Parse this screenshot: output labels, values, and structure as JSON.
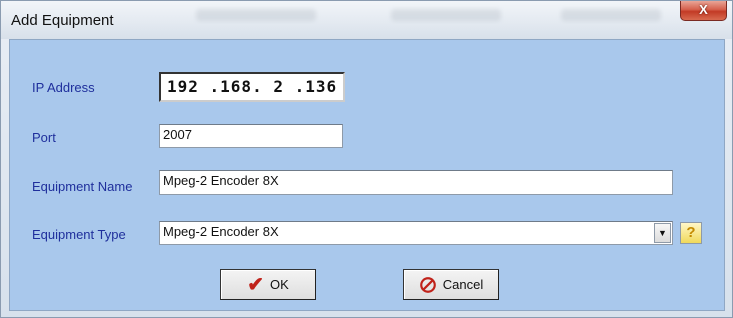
{
  "window": {
    "title": "Add Equipment",
    "close_label": "X"
  },
  "form": {
    "ip_label": "IP Address",
    "ip_value": "192 .168. 2  .136",
    "port_label": "Port",
    "port_value": "2007",
    "name_label": "Equipment Name",
    "name_value": "Mpeg-2 Encoder 8X",
    "type_label": "Equipment Type",
    "type_value": "Mpeg-2 Encoder 8X",
    "help_label": "?"
  },
  "buttons": {
    "ok_label": "OK",
    "cancel_label": "Cancel"
  },
  "icons": {
    "ok": "checkmark-icon",
    "cancel": "no-entry-icon",
    "dropdown": "chevron-down-icon",
    "help": "help-icon"
  },
  "colors": {
    "client_bg": "#a9c8ec",
    "label": "#1f2f9c",
    "close": "#c23a25"
  }
}
